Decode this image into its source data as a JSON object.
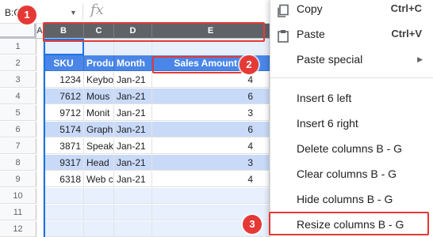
{
  "formula_bar": {
    "name_box": "B:G",
    "fx": "fx"
  },
  "columns": [
    {
      "id": "A",
      "label": "A",
      "selected": false
    },
    {
      "id": "B",
      "label": "B",
      "selected": true
    },
    {
      "id": "C",
      "label": "C",
      "selected": true
    },
    {
      "id": "D",
      "label": "D",
      "selected": true
    },
    {
      "id": "E",
      "label": "E",
      "selected": true
    }
  ],
  "rows": [
    "1",
    "2",
    "3",
    "4",
    "5",
    "6",
    "7",
    "8",
    "9",
    "10",
    "11",
    "12"
  ],
  "table": {
    "headers": [
      "SKU",
      "Produ",
      "Month",
      "Sales Amount"
    ],
    "data": [
      [
        "1234",
        "Keybo",
        "Jan-21",
        "4"
      ],
      [
        "7612",
        "Mous",
        "Jan-21",
        "6"
      ],
      [
        "9712",
        "Monit",
        "Jan-21",
        "3"
      ],
      [
        "5174",
        "Graph",
        "Jan-21",
        "6"
      ],
      [
        "3871",
        "Speak",
        "Jan-21",
        "4"
      ],
      [
        "9317",
        "Head",
        "Jan-21",
        "3"
      ],
      [
        "6318",
        "Web c",
        "Jan-21",
        "4"
      ]
    ]
  },
  "menu": {
    "copy": {
      "label": "Copy",
      "shortcut": "Ctrl+C"
    },
    "paste": {
      "label": "Paste",
      "shortcut": "Ctrl+V"
    },
    "paste_special": {
      "label": "Paste special"
    },
    "insert_left": "Insert 6 left",
    "insert_right": "Insert 6 right",
    "delete_cols": "Delete columns B - G",
    "clear_cols": "Clear columns B - G",
    "hide_cols": "Hide columns B - G",
    "resize_cols": "Resize columns B - G"
  },
  "annotations": {
    "badge1": "1",
    "badge2": "2",
    "badge3": "3"
  },
  "colors": {
    "header_blue": "#4a86e8",
    "band_blue": "#c9daf8",
    "annotation_red": "#e53935",
    "selected_header": "#5f6368"
  }
}
